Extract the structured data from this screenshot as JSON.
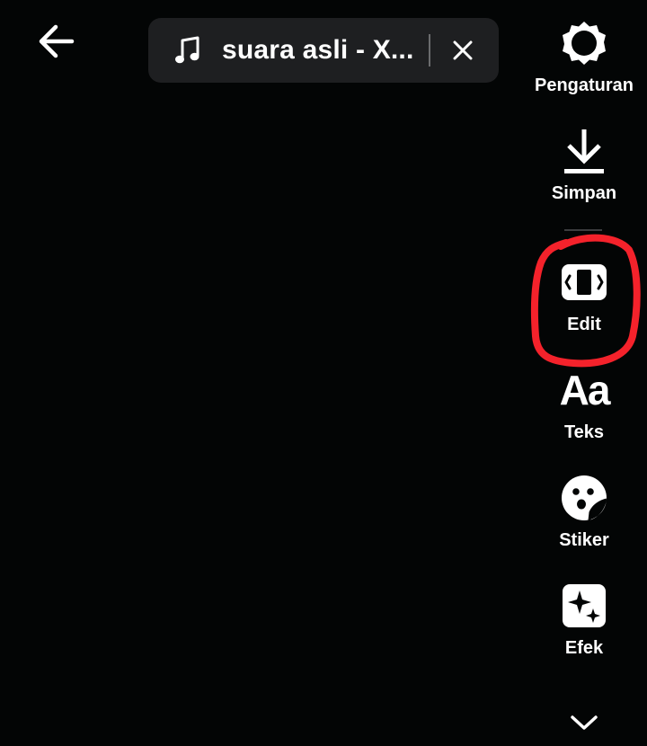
{
  "header": {
    "back_icon": "arrow-left-icon",
    "sound": {
      "icon": "music-note-icon",
      "title": "suara asli - X...",
      "close_icon": "close-icon"
    }
  },
  "toolbar": {
    "items": [
      {
        "label": "Pengaturan",
        "icon": "gear-icon"
      },
      {
        "label": "Simpan",
        "icon": "download-icon"
      },
      {
        "label": "Edit",
        "icon": "edit-clip-icon"
      },
      {
        "label": "Teks",
        "icon": "text-icon",
        "glyph": "Aa"
      },
      {
        "label": "Stiker",
        "icon": "sticker-icon"
      },
      {
        "label": "Efek",
        "icon": "effects-sparkle-icon"
      }
    ],
    "more_icon": "chevron-down-icon"
  },
  "annotation": {
    "color": "#f4222b",
    "target": "Edit"
  }
}
